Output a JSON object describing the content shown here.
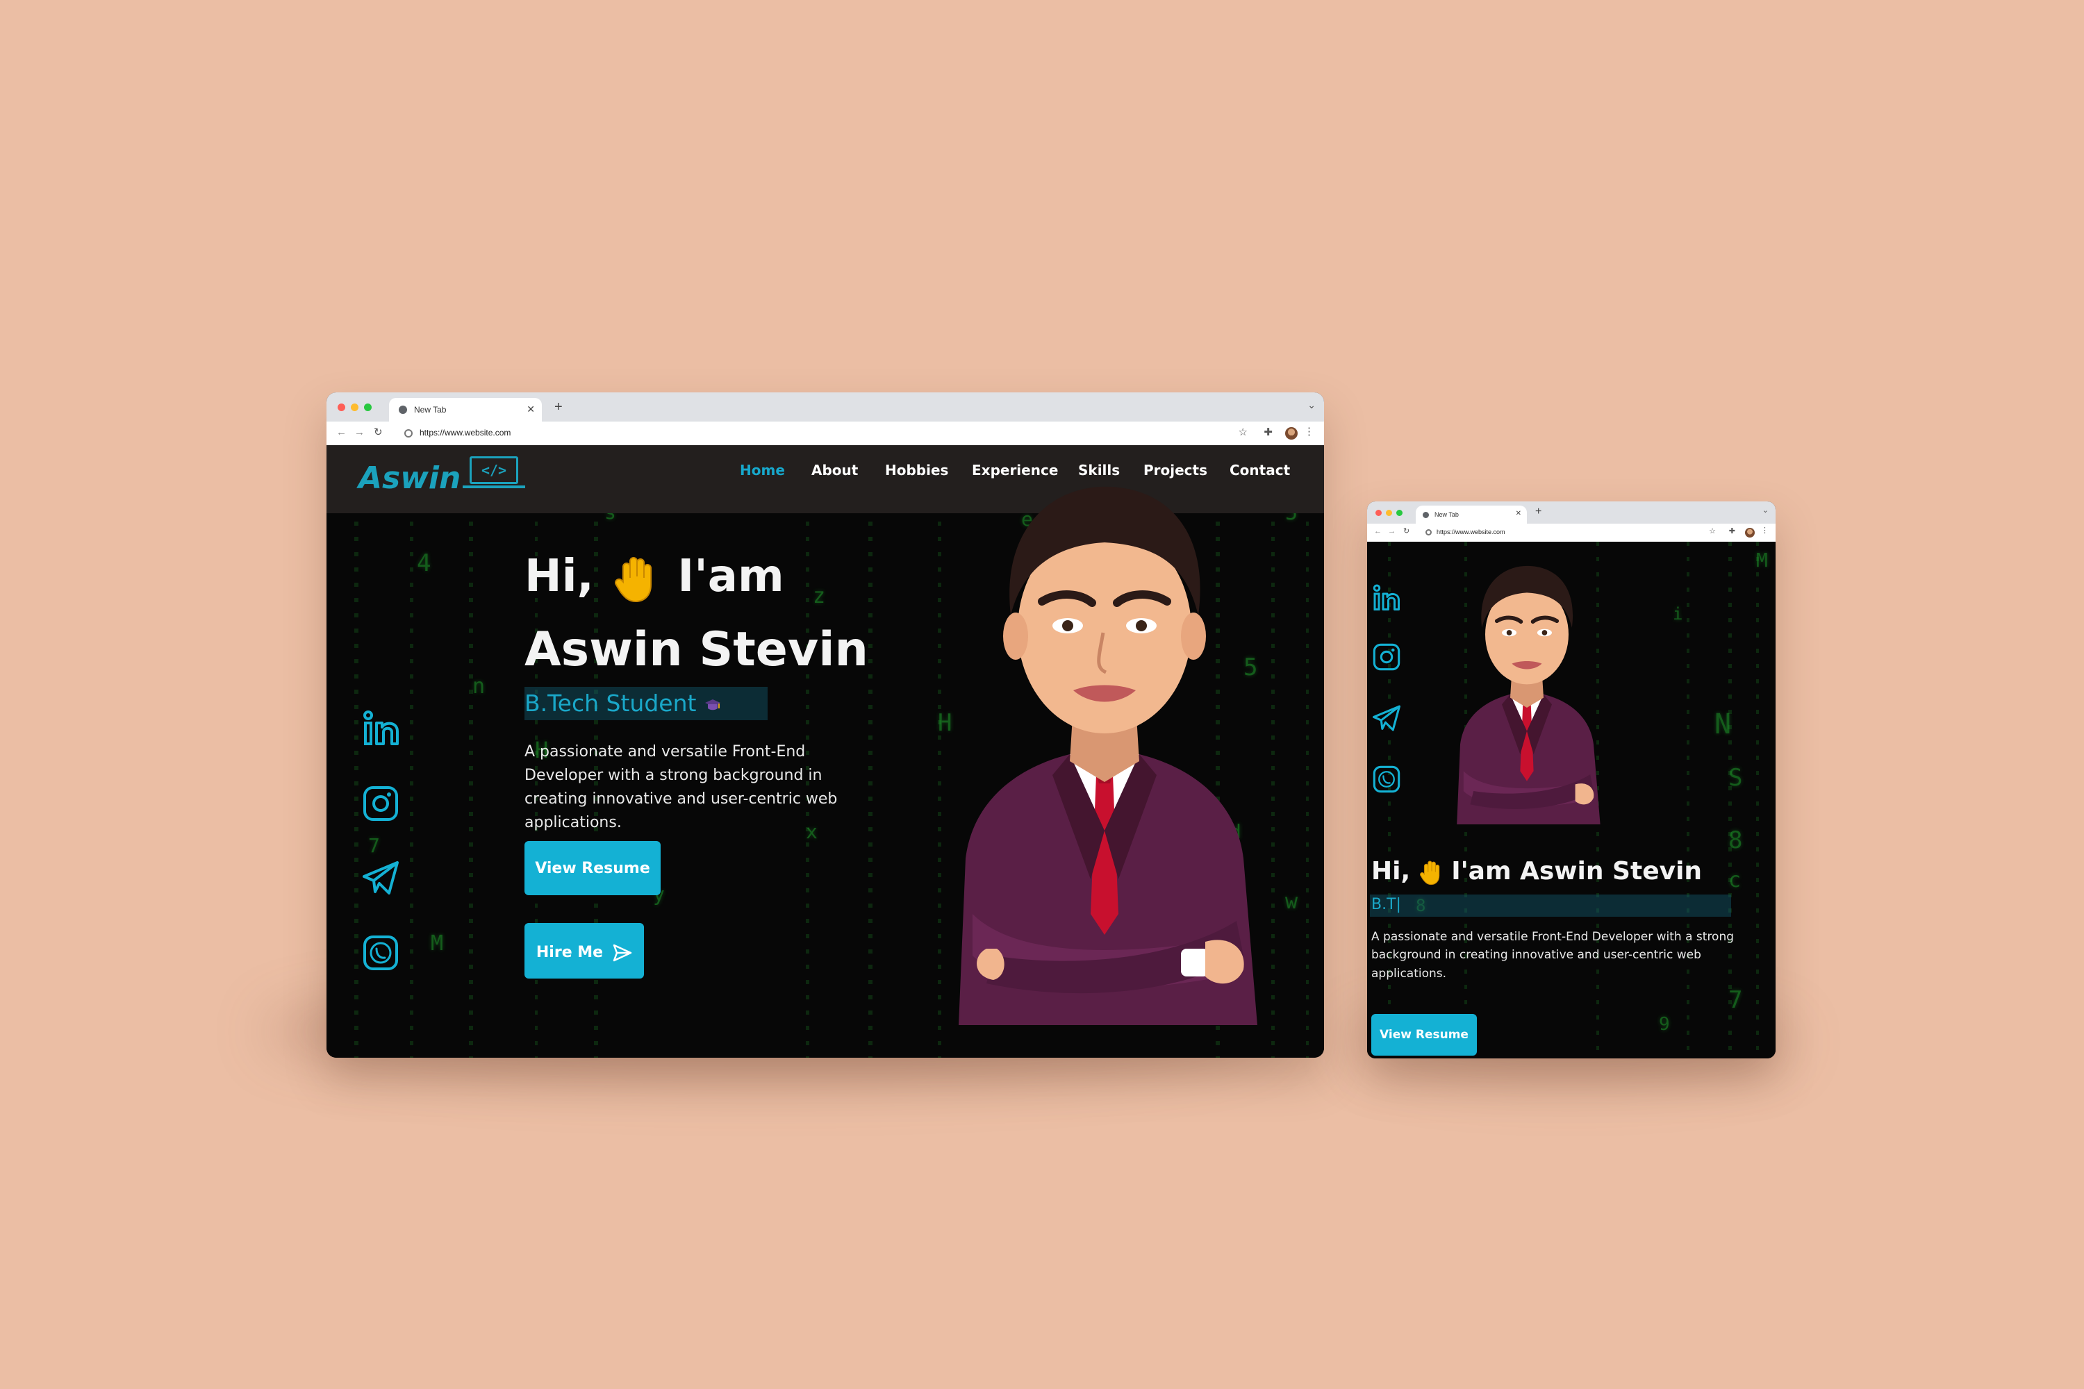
{
  "desktop": {
    "tab_title": "New Tab",
    "url": "https://www.website.com",
    "logo_text": "Aswin",
    "logo_icon_text": "</>",
    "nav": {
      "home": "Home",
      "about": "About",
      "hobbies": "Hobbies",
      "experience": "Experience",
      "skills": "Skills",
      "projects": "Projects",
      "contact": "Contact"
    },
    "greeting": "Hi,",
    "greeting_rest": "I'am",
    "name": "Aswin Stevin",
    "role": "B.Tech Student",
    "description": "A passionate and versatile Front-End Developer with a strong background in creating innovative and user-centric web applications.",
    "buttons": {
      "resume": "View Resume",
      "hire": "Hire Me"
    }
  },
  "mobile": {
    "tab_title": "New Tab",
    "url": "https://www.website.com",
    "greeting": "Hi,",
    "greeting_rest": "I'am Aswin Stevin",
    "role": "B.T|",
    "description": "A passionate and versatile Front-End Developer with a strong background in creating innovative and user-centric web applications.",
    "buttons": {
      "resume": "View Resume"
    }
  },
  "icons": {
    "social": [
      "linkedin-icon",
      "instagram-icon",
      "telegram-icon",
      "whatsapp-icon"
    ],
    "wave": "raised-hand-emoji"
  },
  "colors": {
    "background": "#ebbea4",
    "accent": "#14b1d4",
    "nav_bar": "#231f1e",
    "page_bg": "#070707",
    "matrix_green": "#1fa32c",
    "suit": "#5a1f46",
    "tie": "#c8102e"
  }
}
